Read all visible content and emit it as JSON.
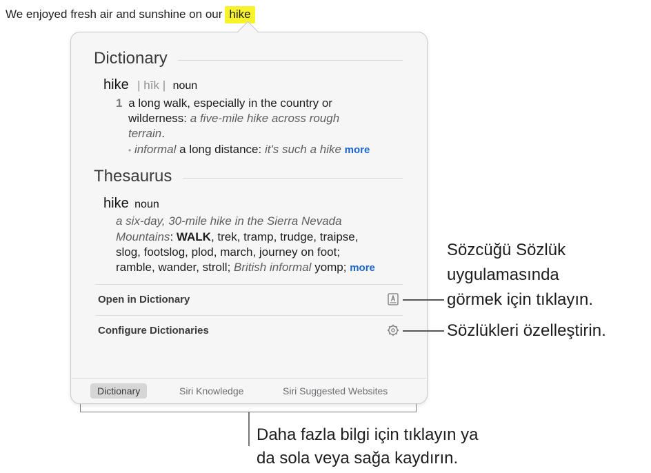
{
  "sentence": {
    "text": "We enjoyed fresh air and sunshine on our",
    "highlighted_word": "hike"
  },
  "dictionary": {
    "heading": "Dictionary",
    "headword": "hike",
    "pronunciation": "| hīk |",
    "part_of_speech": "noun",
    "sense_number": "1",
    "definition_line1": "a long walk, especially in the country or",
    "definition_line2_plain": "wilderness:",
    "definition_line2_example": "a five-mile hike across rough",
    "definition_line3_example": "terrain",
    "definition_line3_end": ".",
    "subsense_label": "informal",
    "subsense_text": "a long distance:",
    "subsense_example": "it's such a hike",
    "more": "more"
  },
  "thesaurus": {
    "heading": "Thesaurus",
    "headword": "hike",
    "part_of_speech": "noun",
    "example_line1": "a six-day, 30-mile hike in the Sierra Nevada",
    "example_line2": "Mountains",
    "example_line2_colon": ":",
    "main_synonym": "WALK",
    "synonyms_line2_rest": ", trek, tramp, trudge, traipse,",
    "synonyms_line3": "slog, footslog, plod, march, journey on foot;",
    "synonyms_line4": "ramble, wander, stroll;",
    "regional_label": "British informal",
    "regional_word": "yomp;",
    "more": "more"
  },
  "actions": {
    "open_in_dictionary": "Open in Dictionary",
    "configure_dictionaries": "Configure Dictionaries"
  },
  "tabs": [
    {
      "label": "Dictionary",
      "active": true
    },
    {
      "label": "Siri Knowledge",
      "active": false
    },
    {
      "label": "Siri Suggested Websites",
      "active": false
    }
  ],
  "callouts": {
    "open_line1": "Sözcüğü Sözlük",
    "open_line2": "uygulamasında",
    "open_line3": "görmek için tıklayın.",
    "configure": "Sözlükleri özelleştirin.",
    "tabs_line1": "Daha fazla bilgi için tıklayın ya",
    "tabs_line2": "da sola veya sağa kaydırın."
  },
  "colors": {
    "highlight": "#f8f32b",
    "link": "#1a66d1",
    "popover_bg": "#f6f6f6"
  },
  "icons": {
    "open": "dictionary-book-icon",
    "configure": "gear-icon"
  }
}
